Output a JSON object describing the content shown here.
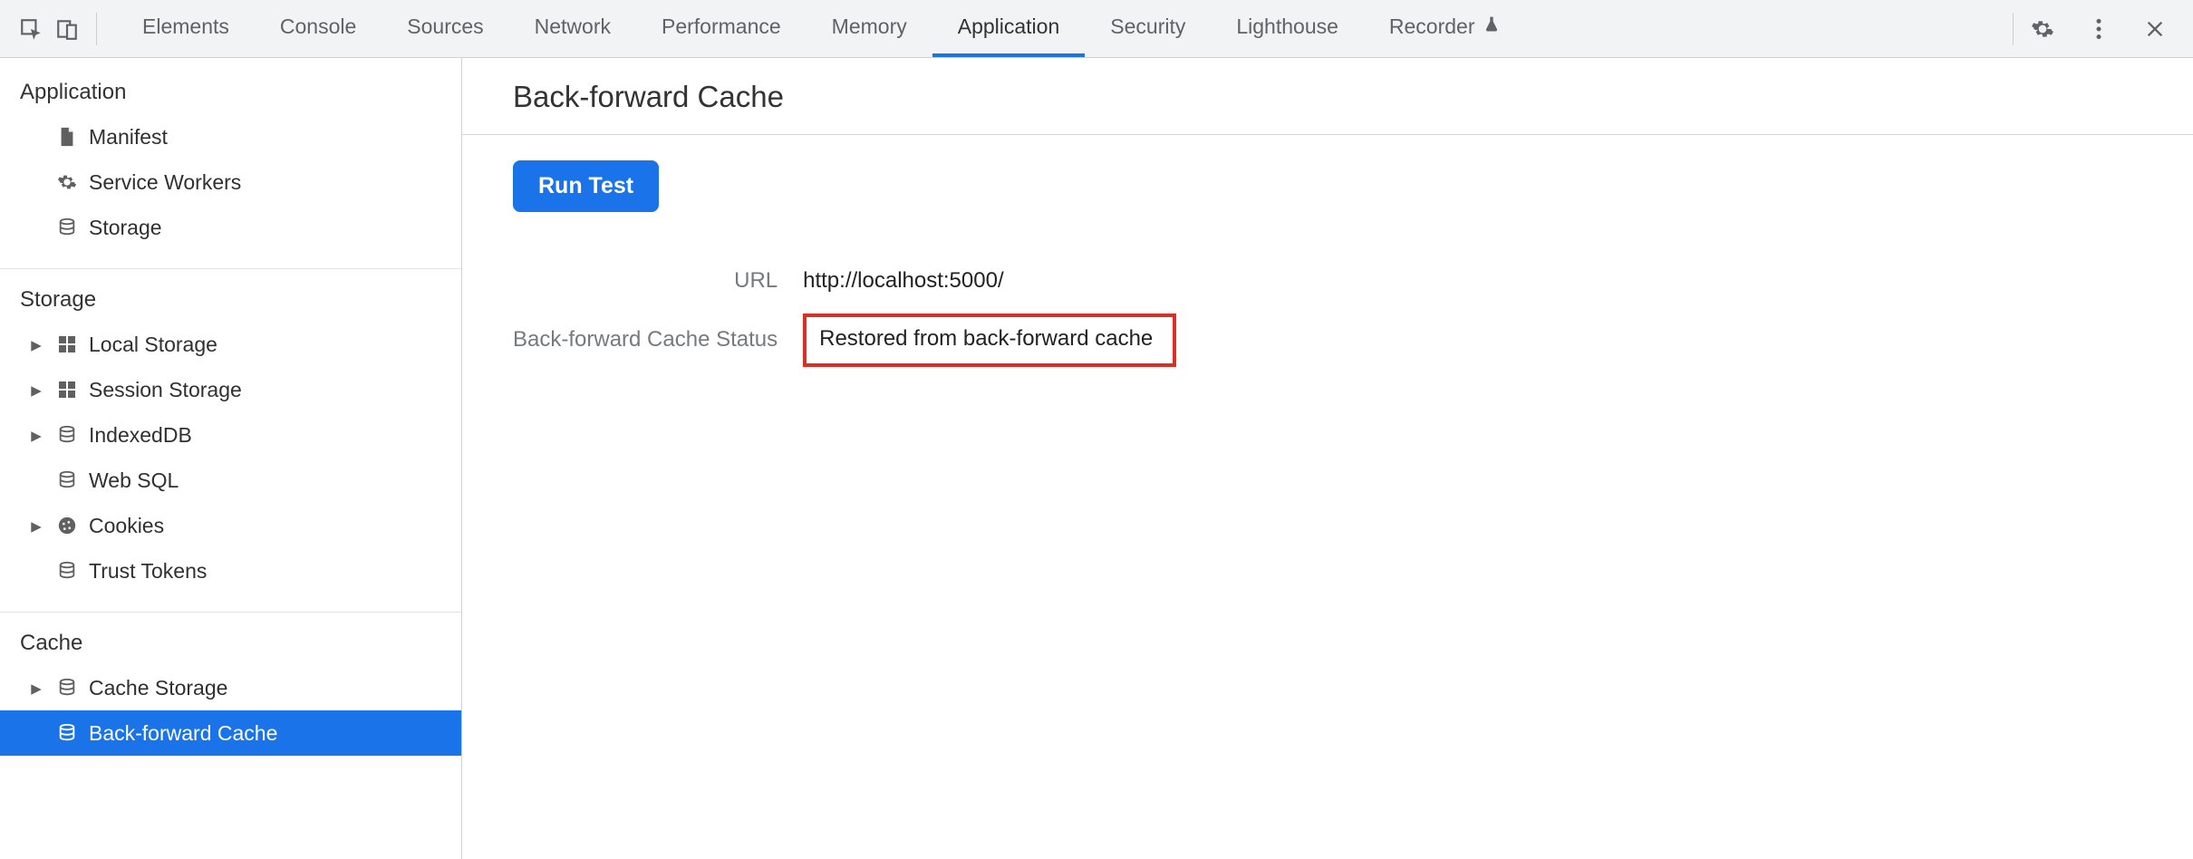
{
  "toolbar": {
    "tabs": [
      {
        "label": "Elements"
      },
      {
        "label": "Console"
      },
      {
        "label": "Sources"
      },
      {
        "label": "Network"
      },
      {
        "label": "Performance"
      },
      {
        "label": "Memory"
      },
      {
        "label": "Application",
        "active": true
      },
      {
        "label": "Security"
      },
      {
        "label": "Lighthouse"
      },
      {
        "label": "Recorder",
        "beta": true
      }
    ]
  },
  "sidebar": {
    "groups": [
      {
        "title": "Application",
        "items": [
          {
            "icon": "document",
            "label": "Manifest"
          },
          {
            "icon": "gear",
            "label": "Service Workers"
          },
          {
            "icon": "db",
            "label": "Storage"
          }
        ]
      },
      {
        "title": "Storage",
        "items": [
          {
            "icon": "grid",
            "label": "Local Storage",
            "expandable": true
          },
          {
            "icon": "grid",
            "label": "Session Storage",
            "expandable": true
          },
          {
            "icon": "db",
            "label": "IndexedDB",
            "expandable": true
          },
          {
            "icon": "db",
            "label": "Web SQL"
          },
          {
            "icon": "cookie",
            "label": "Cookies",
            "expandable": true
          },
          {
            "icon": "db",
            "label": "Trust Tokens"
          }
        ]
      },
      {
        "title": "Cache",
        "items": [
          {
            "icon": "db",
            "label": "Cache Storage",
            "expandable": true
          },
          {
            "icon": "db",
            "label": "Back-forward Cache",
            "selected": true
          }
        ]
      }
    ]
  },
  "page": {
    "title": "Back-forward Cache",
    "runTest": "Run Test",
    "fields": {
      "urlLabel": "URL",
      "urlValue": "http://localhost:5000/",
      "statusLabel": "Back-forward Cache Status",
      "statusValue": "Restored from back-forward cache"
    }
  }
}
